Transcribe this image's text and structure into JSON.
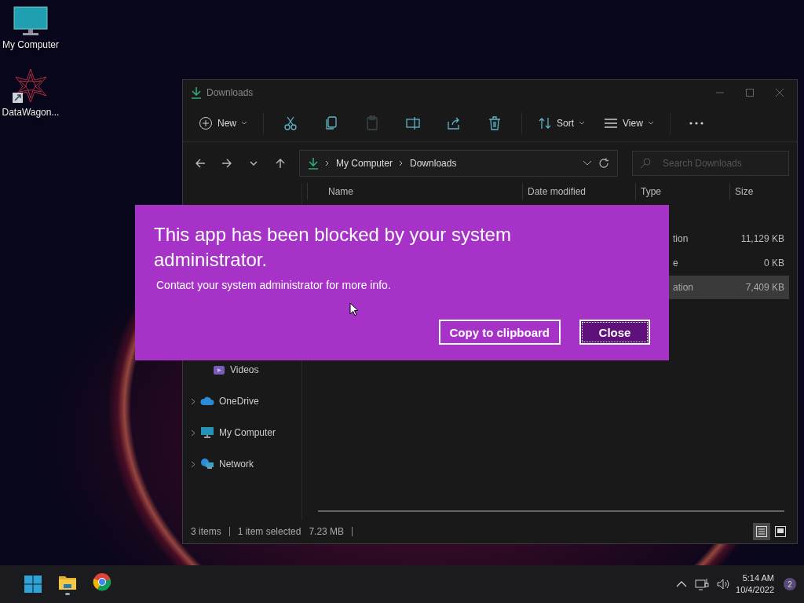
{
  "desktop_icons": [
    {
      "label": "My Computer",
      "kind": "monitor"
    },
    {
      "label": "DataWagon...",
      "kind": "shortcut"
    }
  ],
  "explorer": {
    "title": "Downloads",
    "toolbar": {
      "new": "New",
      "paste": {
        "disabled": true
      },
      "sort": "Sort",
      "view": "View"
    },
    "breadcrumb": [
      "My Computer",
      "Downloads"
    ],
    "search": {
      "placeholder": "Search Downloads"
    },
    "columns": [
      "Name",
      "Date modified",
      "Type",
      "Size"
    ],
    "rows": [
      {
        "column_type": "tion",
        "size": "11,129 KB",
        "selected": false
      },
      {
        "column_type": "e",
        "size": "0 KB",
        "selected": false
      },
      {
        "column_type": "ation",
        "size": "7,409 KB",
        "selected": true
      }
    ],
    "sidebar": [
      {
        "label": "Videos",
        "kind": "videos",
        "expandable": false
      },
      {
        "label": "OneDrive",
        "kind": "cloud",
        "expandable": true
      },
      {
        "label": "My Computer",
        "kind": "computer",
        "expandable": true
      },
      {
        "label": "Network",
        "kind": "network",
        "expandable": true
      }
    ],
    "status": {
      "count": "3 items",
      "selection": "1 item selected",
      "size": "7.23 MB"
    },
    "view_modes": [
      {
        "kind": "details",
        "selected": true
      },
      {
        "kind": "tiles",
        "selected": false
      }
    ]
  },
  "dialog": {
    "title": "This app has been blocked by your system administrator.",
    "message": "Contact your system administrator for more info.",
    "buttons": [
      {
        "label": "Copy to clipboard",
        "default": false
      },
      {
        "label": "Close",
        "default": true
      }
    ]
  },
  "taskbar": {
    "apps": [
      {
        "kind": "folder",
        "running": true
      },
      {
        "kind": "browser",
        "running": false
      }
    ],
    "time": "5:14 AM",
    "date": "10/4/2022",
    "notifications": "2"
  }
}
